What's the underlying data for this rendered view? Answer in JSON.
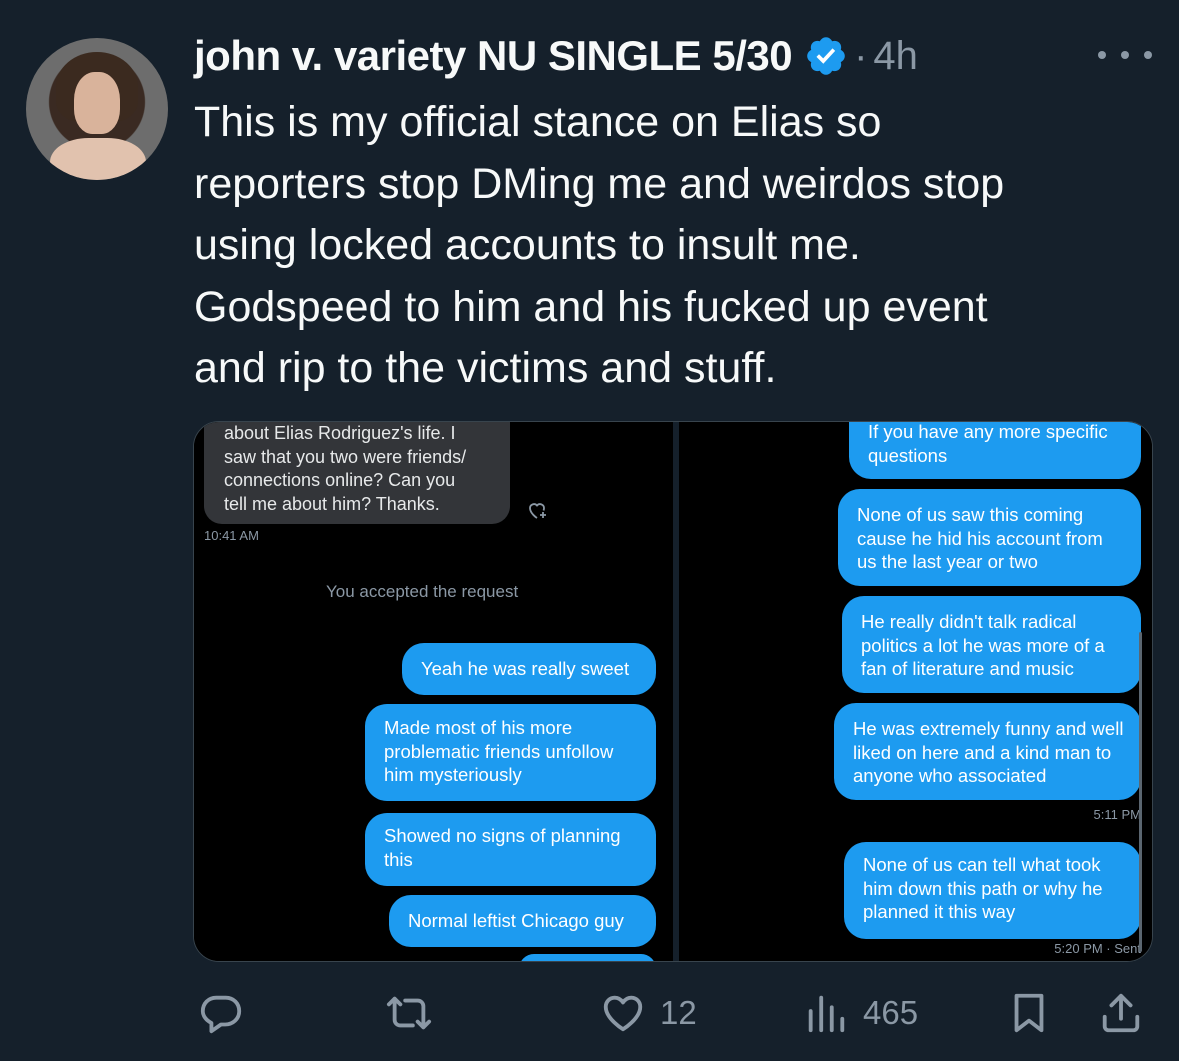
{
  "tweet": {
    "author_name": "john v. variety NU SINGLE 5/30",
    "separator": "·",
    "time": "4h",
    "text_lines": [
      "This is my official stance on Elias so",
      "reporters stop DMing me and weirdos stop",
      "using locked accounts to insult me.",
      "Godspeed to him and his fucked up event",
      "and rip to the victims and stuff."
    ]
  },
  "media": {
    "left": {
      "incoming_lines": [
        "about Elias Rodriguez's life. I",
        "saw that you two were friends/",
        "connections online? Can you",
        "tell me about him? Thanks."
      ],
      "incoming_time": "10:41 AM",
      "system_message": "You accepted the request",
      "messages": [
        "Yeah he was really sweet",
        "Made most of his more problematic friends unfollow him mysteriously",
        "Showed no signs of planning this",
        "Normal leftist Chicago guy"
      ]
    },
    "right": {
      "messages": [
        "If you have any more specific questions",
        "None of us saw this coming cause he hid his account from us the last year or two",
        "He really didn't talk radical politics a lot he was more of a fan of literature and music",
        "He was extremely funny and well liked on here and a kind man to anyone who associated",
        "None of us can tell what took him down this path or why he planned it this way"
      ],
      "time_1": "5:11 PM",
      "time_2": "5:20 PM · Sent"
    }
  },
  "actions": {
    "reply_icon": "reply-icon",
    "retweet_icon": "retweet-icon",
    "like_count": "12",
    "views_count": "465",
    "bookmark_icon": "bookmark-icon",
    "share_icon": "share-icon"
  },
  "colors": {
    "background": "#15202b",
    "accent_blue": "#1d9bf0",
    "muted": "#8b98a5",
    "text": "#f7f9f9"
  }
}
